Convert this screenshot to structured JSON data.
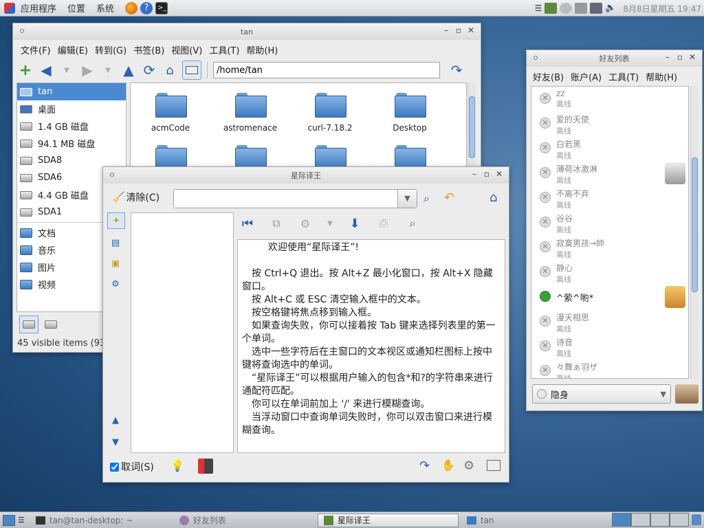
{
  "top_panel": {
    "menus": [
      "应用程序",
      "位置",
      "系统"
    ],
    "clock": "8月8日星期五 19:47"
  },
  "file_manager": {
    "title": "tan",
    "menu": [
      "文件(F)",
      "编辑(E)",
      "转到(G)",
      "书签(B)",
      "视图(V)",
      "工具(T)",
      "帮助(H)"
    ],
    "location": "/home/tan",
    "places": [
      "tan",
      "桌面",
      "1.4 GB 磁盘",
      "94.1 MB 磁盘",
      "SDA8",
      "SDA6",
      "4.4 GB 磁盘",
      "SDA1"
    ],
    "bookmarks": [
      "文档",
      "音乐",
      "图片",
      "视频"
    ],
    "folders": [
      "acmCode",
      "astromenace",
      "curl-7.18.2",
      "Desktop"
    ],
    "status": "45 visible items (93"
  },
  "buddy_list": {
    "title": "好友列表",
    "menu": [
      "好友(B)",
      "账户(A)",
      "工具(T)",
      "帮助(H)"
    ],
    "friends": [
      {
        "name": "zz",
        "status": "离线"
      },
      {
        "name": "爱的天使",
        "status": "离线"
      },
      {
        "name": "白若黑",
        "status": "离线"
      },
      {
        "name": "薄荷冰激淋",
        "status": "离线"
      },
      {
        "name": "不离不弃",
        "status": "离线"
      },
      {
        "name": "谷谷",
        "status": "离线"
      },
      {
        "name": "寂寞男孩→帥",
        "status": "离线"
      },
      {
        "name": "静心",
        "status": "离线"
      },
      {
        "name": "^萦^喲*",
        "status": ""
      },
      {
        "name": "漫天相思",
        "status": "离线"
      },
      {
        "name": "诗音",
        "status": "离线"
      },
      {
        "name": "々舞ぁ羽ザ",
        "status": "离线"
      }
    ],
    "presence": "隐身"
  },
  "stardict": {
    "title": "星际译王",
    "clear_label": "清除(C)",
    "search_value": "",
    "welcome": [
      "欢迎使用“星际译王”!",
      "",
      "按 Ctrl+Q 退出。按 Alt+Z 最小化窗口，按 Alt+X 隐藏窗口。",
      "按 Alt+C 或 ESC 清空输入框中的文本。",
      "按空格键将焦点移到输入框。",
      "如果查询失败，你可以接着按 Tab 键来选择列表里的第一个单词。",
      "选中一些字符后在主窗口的文本视区或通知栏图标上按中键将查询选中的单词。",
      "“星际译王”可以根据用户输入的包含*和?的字符串来进行通配符匹配。",
      "你可以在单词前加上 '/' 来进行模糊查询。",
      "当浮动窗口中查询单词失败时，你可以双击窗口来进行模糊查询。"
    ],
    "scan_label": "取词(S)",
    "scan_checked": true
  },
  "taskbar": {
    "tasks": [
      "tan@tan-desktop: ~",
      "好友列表",
      "星际译王",
      "tan"
    ]
  },
  "colors": {
    "accent": "#4b86c3",
    "online": "#3aa23a"
  }
}
